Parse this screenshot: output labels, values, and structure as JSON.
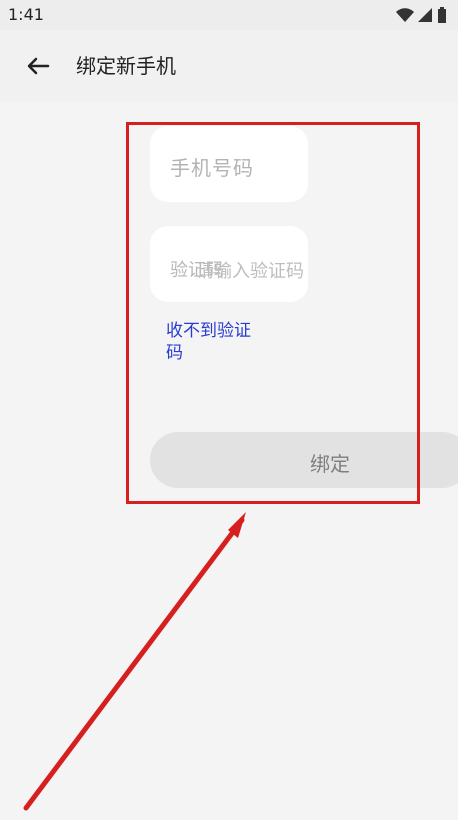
{
  "status_bar": {
    "time": "1:41"
  },
  "app_bar": {
    "title": "绑定新手机"
  },
  "form": {
    "phone_placeholder": "手机号码",
    "code_label": "验证码",
    "code_placeholder": "请输入验证码",
    "cannot_receive": "收不到验证码",
    "bind_button": "绑定"
  },
  "colors": {
    "highlight": "#d61f1f",
    "link": "#2a3bd3"
  },
  "icons": {
    "back": "arrow-left-icon",
    "wifi": "wifi-icon",
    "signal": "signal-icon",
    "battery": "battery-icon"
  }
}
